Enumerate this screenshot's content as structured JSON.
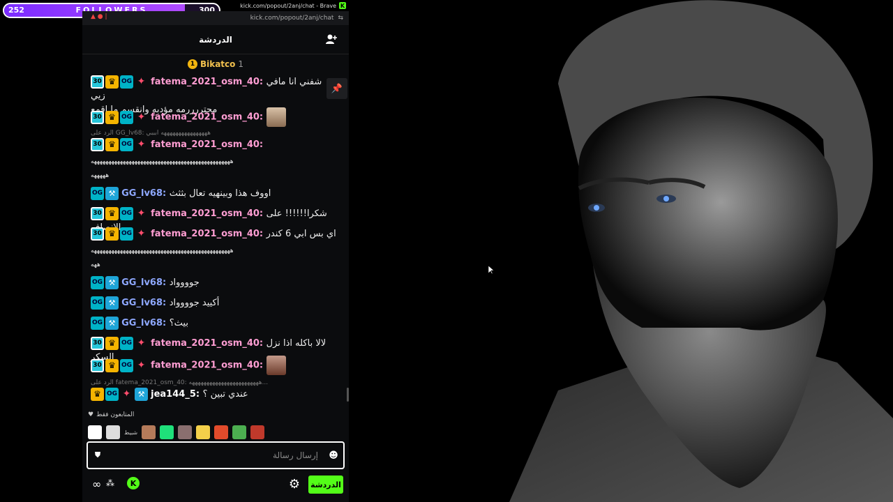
{
  "followers_goal": {
    "current": "252",
    "label": "FOLLOWERS",
    "goal": "300",
    "progress_fraction": 0.84
  },
  "browser": {
    "title": "kick.com/popout/2anj/chat - Brave",
    "url": "kick.com/popout/2anj/chat"
  },
  "chat": {
    "header_title": "الدردشة",
    "pinned": {
      "rank": "1",
      "name": "Bikatco",
      "count": "1"
    },
    "messages": [
      {
        "user": "fatema_2021_osm_40",
        "badges": [
          "30",
          "vip",
          "og",
          "fire"
        ],
        "text": "شفني انا مافي زيي",
        "text2": "محتررررمه مؤدبه وانقسم ما اقمع"
      },
      {
        "user": "fatema_2021_osm_40",
        "badges": [
          "30",
          "vip",
          "og",
          "fire"
        ],
        "text": "",
        "emote": "baby-emote"
      },
      {
        "reply": "الرد على GG_lv68: ههههههههههههههههه ابببي"
      },
      {
        "user": "fatema_2021_osm_40",
        "badges": [
          "30",
          "vip",
          "og",
          "fire"
        ],
        "text": ""
      },
      {
        "text_only": "ههههههههههههههههههههههههههههههههههههههههههههههههه"
      },
      {
        "text_only": "هههههه"
      },
      {
        "user": "GG_lv68",
        "badges": [
          "og",
          "mod"
        ],
        "text": "اووف هذا وبينهيه تعال بثثث"
      },
      {
        "user": "fatema_2021_osm_40",
        "badges": [
          "30",
          "vip",
          "og",
          "fire"
        ],
        "text": "شكرا!!!!!! على الانصاف"
      },
      {
        "user": "fatema_2021_osm_40",
        "badges": [
          "30",
          "vip",
          "og",
          "fire"
        ],
        "text": "اي بس ابي 6 كندر"
      },
      {
        "text_only": "ههههههههههههههههههههههههههههههههههههههههههههههههه"
      },
      {
        "text_only": "ههه"
      },
      {
        "user": "GG_lv68",
        "badges": [
          "og",
          "mod"
        ],
        "text": "جوووواد"
      },
      {
        "user": "GG_lv68",
        "badges": [
          "og",
          "mod"
        ],
        "text": "أكييد جوووواد"
      },
      {
        "user": "GG_lv68",
        "badges": [
          "og",
          "mod"
        ],
        "text": "بيث؟"
      },
      {
        "user": "fatema_2021_osm_40",
        "badges": [
          "30",
          "vip",
          "og",
          "fire"
        ],
        "text": "لالا باكله اذا نزل السكر"
      },
      {
        "user": "fatema_2021_osm_40",
        "badges": [
          "30",
          "vip",
          "og",
          "fire"
        ],
        "text": "",
        "emote": "man-emote"
      },
      {
        "reply": "الرد على fatema_2021_osm_40: ههههههههههههههههههههههههه..."
      },
      {
        "user": "jea144_5",
        "badges": [
          "vip",
          "og",
          "fire",
          "mod"
        ],
        "text": "عندي تبين ؟"
      }
    ],
    "followers_only_label": "المتابعون فقط",
    "emote_bar_text": "شبيط",
    "input_placeholder": "إرسال رسالة",
    "send_button": "الدردشة"
  },
  "colors": {
    "kick_green": "#53fc18",
    "followers_purple": "#7b2cff",
    "fatema_color": "#ff9dd2",
    "gg_color": "#8ea8ff"
  }
}
